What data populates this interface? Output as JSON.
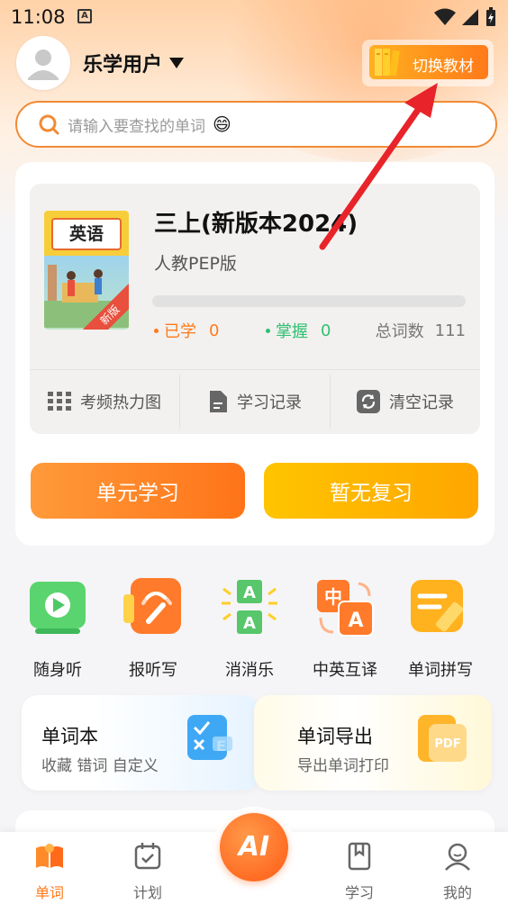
{
  "status_bar": {
    "time": "11:08",
    "indicator": "A"
  },
  "header": {
    "user_name": "乐学用户",
    "switch_label": "切换教材"
  },
  "search": {
    "placeholder": "请输入要查找的单词",
    "emoji": "😄"
  },
  "book": {
    "cover_title": "英语",
    "cover_badge": "新版",
    "title": "三上(新版本2024)",
    "edition": "人教PEP版",
    "progress": 0,
    "learned_label": "已学",
    "learned_value": "0",
    "mastered_label": "掌握",
    "mastered_value": "0",
    "total_label": "总词数",
    "total_value": "111"
  },
  "tools": [
    {
      "label": "考频热力图",
      "icon": "grid-icon"
    },
    {
      "label": "学习记录",
      "icon": "document-icon"
    },
    {
      "label": "清空记录",
      "icon": "refresh-icon"
    }
  ],
  "actions": {
    "unit_study": "单元学习",
    "review": "暂无复习"
  },
  "features": [
    {
      "label": "随身听",
      "icon": "play-icon"
    },
    {
      "label": "报听写",
      "icon": "sound-pencil-icon"
    },
    {
      "label": "消消乐",
      "icon": "match-icon"
    },
    {
      "label": "中英互译",
      "icon": "translate-icon"
    },
    {
      "label": "单词拼写",
      "icon": "spelling-icon"
    }
  ],
  "cards": {
    "wordbook": {
      "title": "单词本",
      "subtitle": "收藏 错词 自定义"
    },
    "export": {
      "title": "单词导出",
      "subtitle": "导出单词打印",
      "icon_text": "PDF"
    }
  },
  "nav": {
    "words": "单词",
    "plan": "计划",
    "ai": "AI",
    "study": "学习",
    "mine": "我的"
  },
  "colors": {
    "accent": "#ff7a1a",
    "mastered": "#2fbf71",
    "arrow": "#e8232a"
  }
}
